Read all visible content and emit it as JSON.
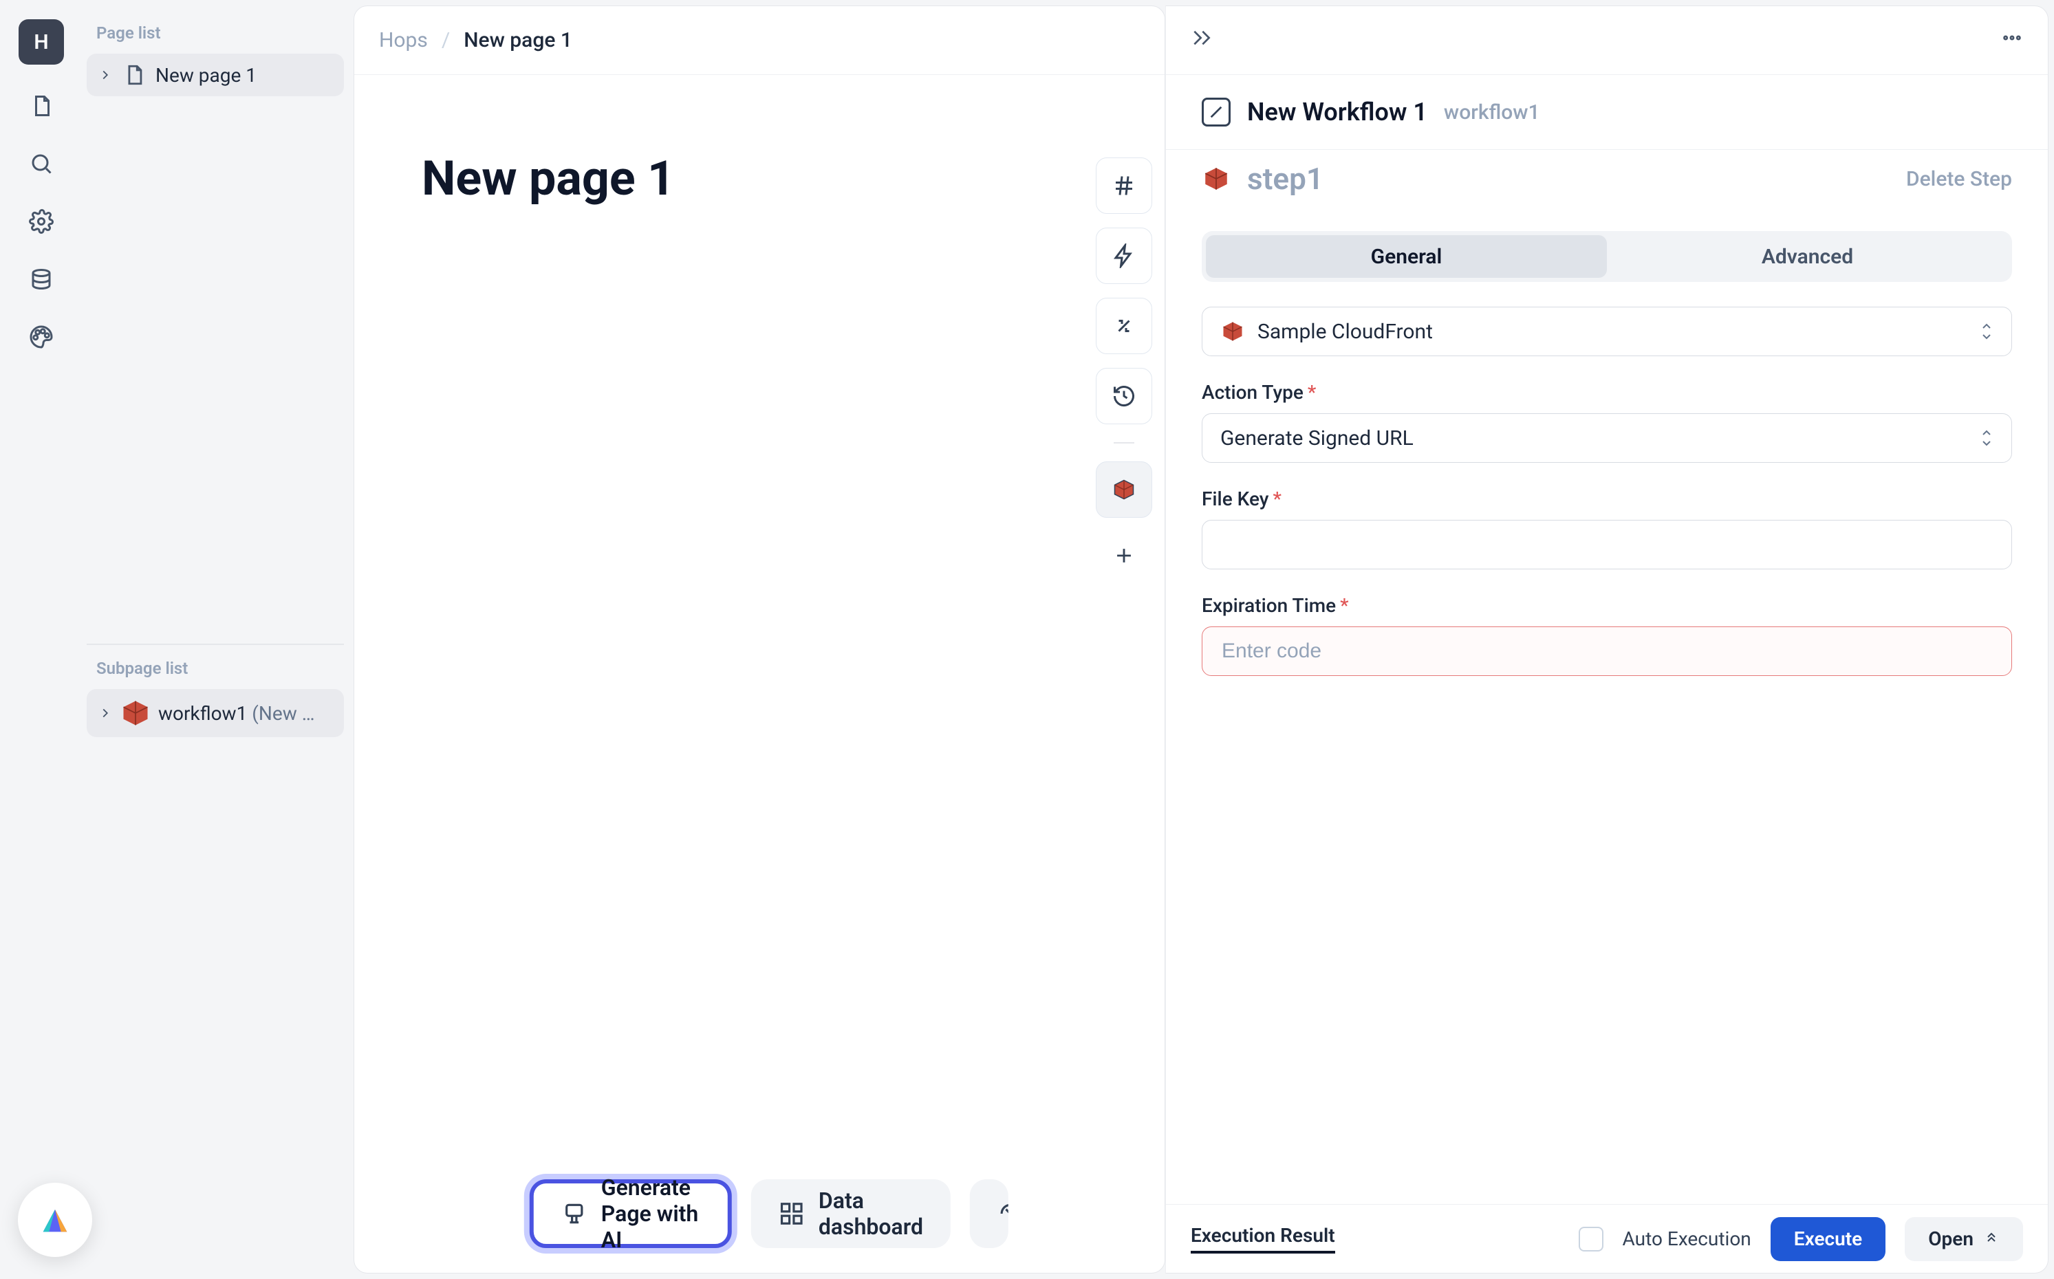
{
  "rail": {
    "avatar_letter": "H"
  },
  "sidepanel": {
    "page_list_heading": "Page list",
    "pages": [
      {
        "name": "New page 1"
      }
    ],
    "subpage_list_heading": "Subpage list",
    "subpages": [
      {
        "name": "workflow1",
        "suffix": "(New …"
      }
    ]
  },
  "canvas": {
    "breadcrumb_root": "Hops",
    "breadcrumb_sep": "/",
    "breadcrumb_current": "New page 1",
    "page_title": "New page 1",
    "float_ai_label": "Generate Page with AI",
    "float_dashboard_label": "Data dashboard"
  },
  "inspector": {
    "workflow_name": "New Workflow 1",
    "workflow_slug": "workflow1",
    "step_name": "step1",
    "delete_step_label": "Delete Step",
    "tab_general": "General",
    "tab_advanced": "Advanced",
    "connector_label": "Sample CloudFront",
    "action_type_label": "Action Type",
    "action_type_value": "Generate Signed URL",
    "file_key_label": "File Key",
    "file_key_value": "",
    "expiration_label": "Expiration Time",
    "expiration_placeholder": "Enter code",
    "expiration_value": "",
    "exec_result_tab": "Execution Result",
    "auto_exec_label": "Auto Execution",
    "execute_btn": "Execute",
    "open_btn": "Open"
  }
}
